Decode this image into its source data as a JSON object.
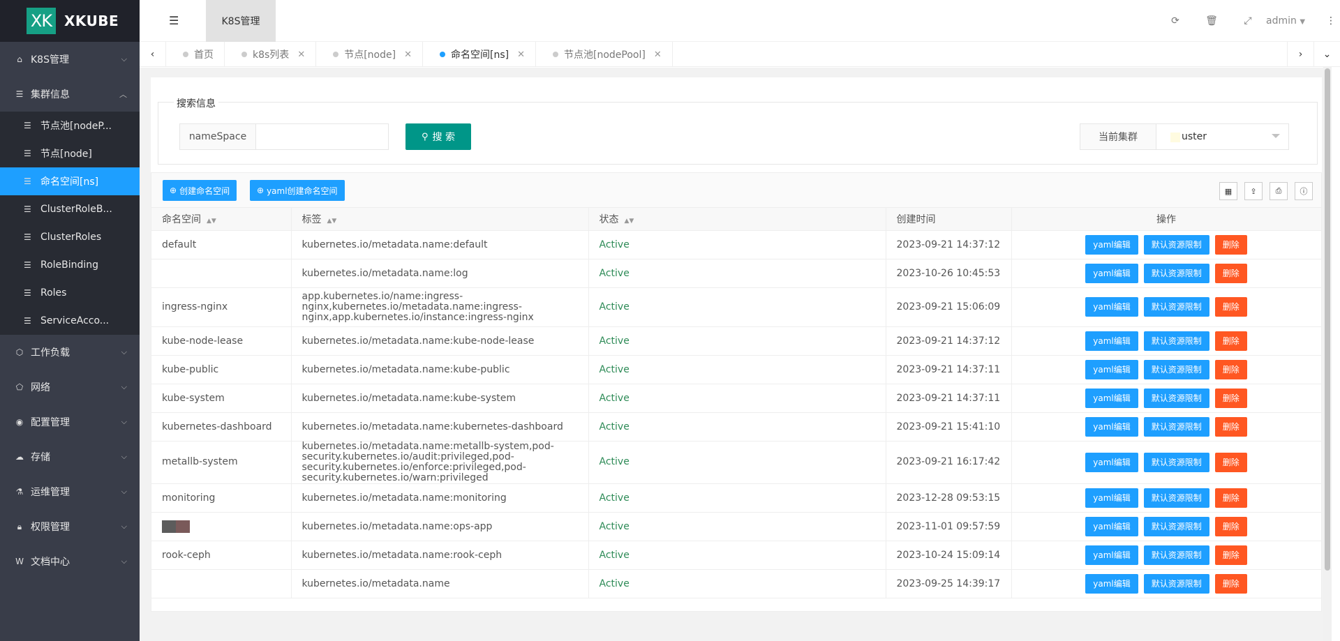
{
  "app": {
    "logo_mark": "XK",
    "logo_text": "XKUBE"
  },
  "sidebar": {
    "items": [
      {
        "label": "K8S管理",
        "icon": "home-icon"
      },
      {
        "label": "集群信息",
        "icon": "server-icon"
      },
      {
        "label": "工作负载",
        "icon": "cube-icon"
      },
      {
        "label": "网络",
        "icon": "network-icon"
      },
      {
        "label": "配置管理",
        "icon": "database-icon"
      },
      {
        "label": "存储",
        "icon": "cloud-icon"
      },
      {
        "label": "运维管理",
        "icon": "flask-icon"
      },
      {
        "label": "权限管理",
        "icon": "lock-icon"
      },
      {
        "label": "文档中心",
        "icon": "doc-icon"
      }
    ],
    "sub_items": [
      {
        "label": "节点池[nodeP...",
        "active": false
      },
      {
        "label": "节点[node]",
        "active": false
      },
      {
        "label": "命名空间[ns]",
        "active": true
      },
      {
        "label": "ClusterRoleB...",
        "active": false
      },
      {
        "label": "ClusterRoles",
        "active": false
      },
      {
        "label": "RoleBinding",
        "active": false
      },
      {
        "label": "Roles",
        "active": false
      },
      {
        "label": "ServiceAcco...",
        "active": false
      }
    ]
  },
  "header": {
    "tab_label": "K8S管理",
    "user": "admin"
  },
  "tabs": [
    {
      "label": "首页",
      "closable": false,
      "active": false
    },
    {
      "label": "k8s列表",
      "closable": true,
      "active": false
    },
    {
      "label": "节点[node]",
      "closable": true,
      "active": false
    },
    {
      "label": "命名空间[ns]",
      "closable": true,
      "active": true
    },
    {
      "label": "节点池[nodePool]",
      "closable": true,
      "active": false
    }
  ],
  "search": {
    "legend": "搜索信息",
    "field_label": "nameSpace",
    "value": "",
    "button_label": "搜 索",
    "cluster_label": "当前集群",
    "cluster_value": "uster"
  },
  "toolbar": {
    "create_label": "创建命名空间",
    "yaml_create_label": "yaml创建命名空间"
  },
  "table": {
    "columns": [
      "命名空间",
      "标签",
      "状态",
      "创建时间",
      "操作"
    ],
    "op_labels": {
      "yaml": "yaml编辑",
      "limit": "默认资源限制",
      "delete": "删除"
    },
    "rows": [
      {
        "name": "default",
        "labels": "kubernetes.io/metadata.name:default",
        "status": "Active",
        "created": "2023-09-21 14:37:12"
      },
      {
        "name": "",
        "labels": "kubernetes.io/metadata.name:log",
        "status": "Active",
        "created": "2023-10-26 10:45:53"
      },
      {
        "name": "ingress-nginx",
        "labels": "app.kubernetes.io/name:ingress-nginx,kubernetes.io/metadata.name:ingress-nginx,app.kubernetes.io/instance:ingress-nginx",
        "status": "Active",
        "created": "2023-09-21 15:06:09"
      },
      {
        "name": "kube-node-lease",
        "labels": "kubernetes.io/metadata.name:kube-node-lease",
        "status": "Active",
        "created": "2023-09-21 14:37:12"
      },
      {
        "name": "kube-public",
        "labels": "kubernetes.io/metadata.name:kube-public",
        "status": "Active",
        "created": "2023-09-21 14:37:11"
      },
      {
        "name": "kube-system",
        "labels": "kubernetes.io/metadata.name:kube-system",
        "status": "Active",
        "created": "2023-09-21 14:37:11"
      },
      {
        "name": "kubernetes-dashboard",
        "labels": "kubernetes.io/metadata.name:kubernetes-dashboard",
        "status": "Active",
        "created": "2023-09-21 15:41:10"
      },
      {
        "name": "metallb-system",
        "labels": "kubernetes.io/metadata.name:metallb-system,pod-security.kubernetes.io/audit:privileged,pod-security.kubernetes.io/enforce:privileged,pod-security.kubernetes.io/warn:privileged",
        "status": "Active",
        "created": "2023-09-21 16:17:42"
      },
      {
        "name": "monitoring",
        "labels": "kubernetes.io/metadata.name:monitoring",
        "status": "Active",
        "created": "2023-12-28 09:53:15"
      },
      {
        "name": "",
        "labels": "kubernetes.io/metadata.name:ops-app",
        "status": "Active",
        "created": "2023-11-01 09:57:59"
      },
      {
        "name": "rook-ceph",
        "labels": "kubernetes.io/metadata.name:rook-ceph",
        "status": "Active",
        "created": "2023-10-24 15:09:14"
      },
      {
        "name": "",
        "labels": "kubernetes.io/metadata.name",
        "status": "Active",
        "created": "2023-09-25 14:39:17"
      }
    ]
  },
  "colors": {
    "accent": "#1e9fff",
    "primary_green": "#009688",
    "danger": "#ff5722",
    "sidebar_bg": "#393d49"
  }
}
